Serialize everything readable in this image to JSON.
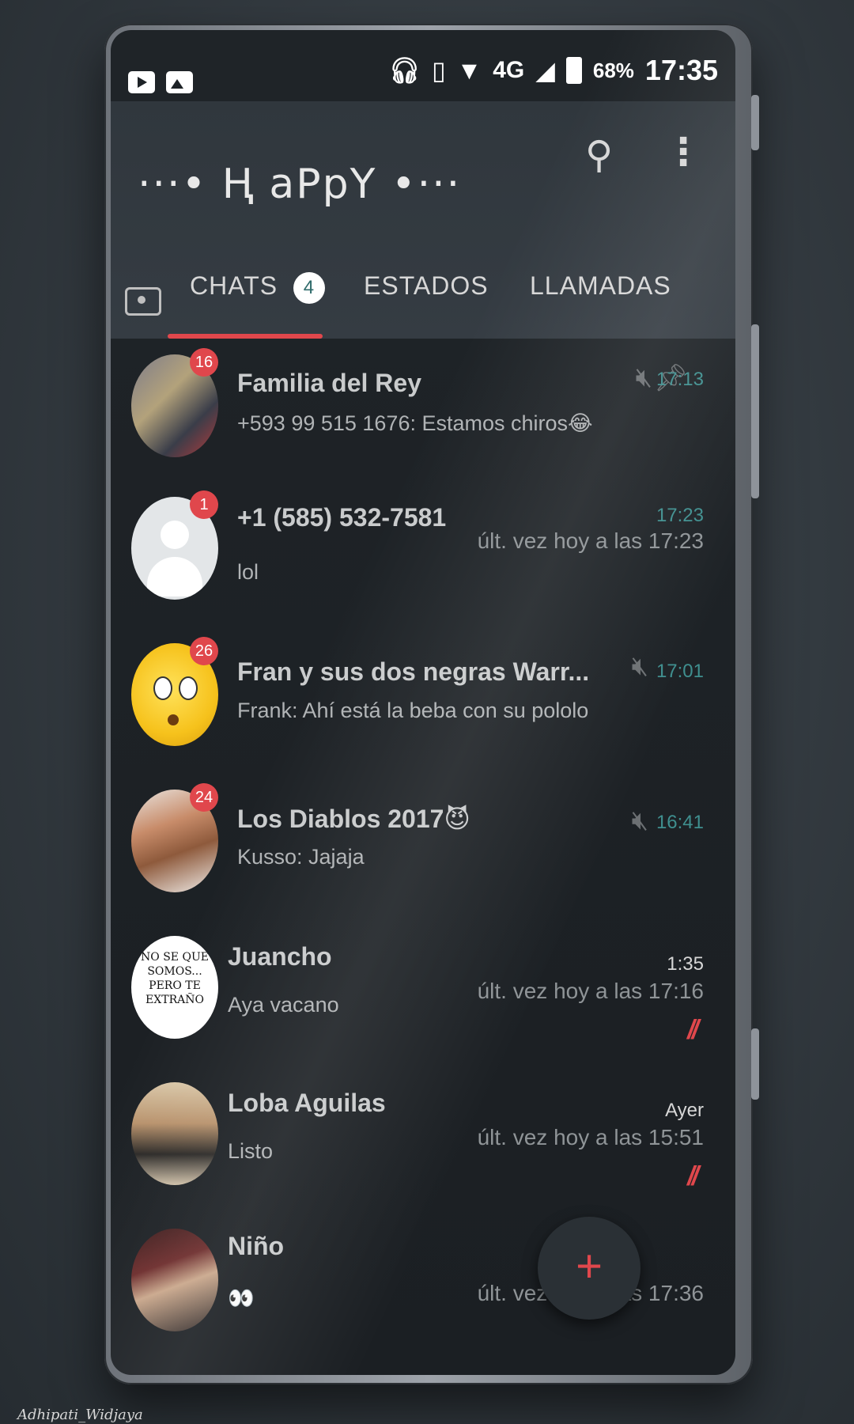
{
  "status_bar": {
    "network": "4G",
    "battery": "68%",
    "time": "17:35"
  },
  "header": {
    "title": "···• Ⱨ aPpY •···",
    "icons": [
      "search-icon",
      "overflow-menu-icon"
    ]
  },
  "tabs": {
    "chats": {
      "label": "CHATS",
      "badge": "4"
    },
    "estados": {
      "label": "ESTADOS"
    },
    "llamadas": {
      "label": "LLAMADAS"
    }
  },
  "chats": [
    {
      "name": "Familia del Rey",
      "message": "+593 99 515 1676: Estamos chiros😂",
      "time": "17:13",
      "unread": "16",
      "muted": true,
      "pinned": true
    },
    {
      "name": "+1 (585) 532-7581",
      "message": "lol",
      "time": "17:23",
      "last_seen": "últ. vez hoy a las 17:23",
      "unread": "1"
    },
    {
      "name": "Fran  y sus   dos   negras Warr...",
      "message": "Frank: Ahí está la beba con su pololo",
      "time": "17:01",
      "unread": "26",
      "muted": true
    },
    {
      "name": "Los Diablos 2017😈",
      "message": "Kusso: Jajaja",
      "time": "16:41",
      "unread": "24",
      "muted": true
    },
    {
      "name": "Juancho",
      "message": "Aya vacano",
      "time": "1:35",
      "last_seen": "últ. vez hoy a las 17:16",
      "avatar_text": "NO SE QUE SOMOS... PERO TE EXTRAÑO"
    },
    {
      "name": "Loba Aguilas",
      "message": "Listo",
      "time": "Ayer",
      "last_seen": "últ. vez hoy a las 15:51"
    },
    {
      "name": "Niño",
      "message": "👀",
      "last_seen": "últ. vez hoy a las 17:36"
    }
  ],
  "fab": {
    "label": "+"
  },
  "signature": "Adhipati_Widjaya",
  "colors": {
    "accent": "#e0474c",
    "teal": "#3f8f8f",
    "background": "#1d2226"
  }
}
